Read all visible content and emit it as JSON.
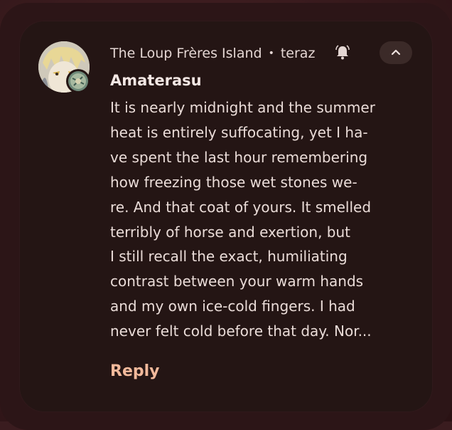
{
  "notification": {
    "app_name": "The Loup Frères Island",
    "separator": "•",
    "time": "teraz",
    "bell_icon": "bell-alert-icon",
    "expand_icon": "chevron-up-icon",
    "sender": "Amaterasu",
    "message_lines": [
      "It is nearly midnight and the summer",
      "heat is entirely suffocating, yet I ha-",
      "ve spent the last hour remembering",
      "how freezing those wet stones we-",
      "re. And that coat of yours. It smelled",
      "terribly of horse and exertion, but",
      "I still recall the exact, humiliating",
      "contrast between your warm hands",
      "and my own ice-cold fingers. I had",
      "never felt cold before that day. Nor..."
    ],
    "reply_label": "Reply"
  },
  "colors": {
    "card_bg": "#241514",
    "reply_accent": "#f2b99b",
    "text": "#eadcd8"
  }
}
